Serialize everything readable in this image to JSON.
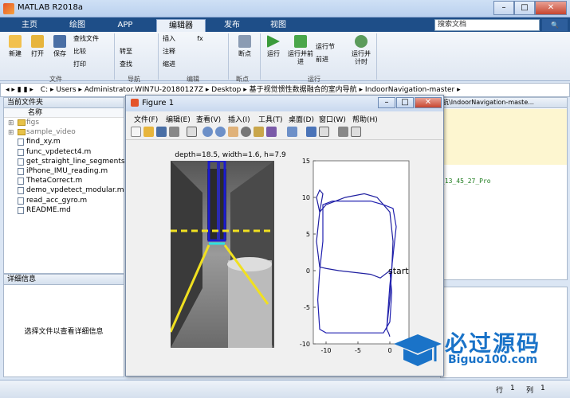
{
  "window": {
    "title": "MATLAB R2018a",
    "min": "–",
    "max": "□",
    "close": "✕"
  },
  "tabs": [
    "主页",
    "绘图",
    "APP",
    "编辑器",
    "发布",
    "视图"
  ],
  "search_placeholder": "搜索文档",
  "ribbon": {
    "buttons": [
      "新建",
      "打开",
      "保存",
      "查找文件",
      "比较",
      "打印",
      "转至",
      "查找",
      "插入",
      "注释",
      "缩进",
      "断点",
      "运行",
      "运行并前进",
      "运行节",
      "前进",
      "运行并计时"
    ],
    "fx": "fx",
    "groups": [
      "文件",
      "导航",
      "编辑",
      "断点",
      "运行"
    ]
  },
  "address": [
    "C:",
    "Users",
    "Administrator.WIN7U-20180127Z",
    "Desktop",
    "基于视觉惯性数据融合的室内导航",
    "IndoorNavigation-master"
  ],
  "current_folder": {
    "title": "当前文件夹",
    "column": "名称",
    "items": [
      {
        "name": "figs",
        "type": "folder"
      },
      {
        "name": "sample_video",
        "type": "folder"
      },
      {
        "name": "find_xy.m",
        "type": "file"
      },
      {
        "name": "func_vpdetect4.m",
        "type": "file"
      },
      {
        "name": "get_straight_line_segments.m",
        "type": "file"
      },
      {
        "name": "iPhone_IMU_reading.m",
        "type": "file"
      },
      {
        "name": "ThetaCorrect.m",
        "type": "file"
      },
      {
        "name": "demo_vpdetect_modular.m",
        "type": "file"
      },
      {
        "name": "read_acc_gyro.m",
        "type": "file"
      },
      {
        "name": "README.md",
        "type": "file"
      }
    ]
  },
  "details": {
    "title": "详细信息",
    "hint": "选择文件以查看详细信息"
  },
  "editor": {
    "path_fragment": "航\\IndoorNavigation-maste...",
    "code_fragment": "_13_45_27_Pro"
  },
  "status": {
    "row_label": "行",
    "row": "1",
    "col_label": "列",
    "col": "1"
  },
  "figure": {
    "title": "Figure 1",
    "menu": [
      "文件(F)",
      "编辑(E)",
      "查看(V)",
      "插入(I)",
      "工具(T)",
      "桌面(D)",
      "窗口(W)",
      "帮助(H)"
    ],
    "image_caption": "depth=18.5, width=1.6, h=7.9",
    "plot_label": "start"
  },
  "chart_data": {
    "type": "line",
    "xlim": [
      -12,
      3
    ],
    "ylim": [
      -10,
      15
    ],
    "xticks": [
      -10,
      -5,
      0
    ],
    "yticks": [
      -10,
      -5,
      0,
      5,
      10,
      15
    ],
    "series": [
      {
        "color": "#1f1fa0",
        "x": [
          0,
          -1.5,
          -3,
          -5,
          -8,
          -10,
          -11,
          -11.5,
          -11,
          -10.5,
          -11,
          -11.5,
          -11,
          -10,
          -7,
          -4,
          -2,
          -1,
          0,
          0.5,
          0.3,
          0,
          -0.5,
          -0.2,
          0
        ],
        "y": [
          0,
          -1,
          -0.5,
          -0.3,
          0,
          0.3,
          0.5,
          4,
          8,
          10.5,
          11,
          10,
          8,
          9,
          10,
          10.5,
          10,
          9,
          8,
          4,
          0,
          -4,
          -8,
          -8.5,
          -9
        ]
      },
      {
        "color": "#2020b0",
        "x": [
          0,
          0.3,
          0,
          -1,
          -4,
          -8,
          -10,
          -11,
          -11.3,
          -11,
          -10.5,
          -10.5,
          -9,
          -6,
          -3,
          -1,
          0.5,
          1,
          0.5,
          0,
          -0.5
        ],
        "y": [
          0,
          -3,
          -7,
          -8.5,
          -8.5,
          -8.5,
          -8.5,
          -8,
          -4,
          0,
          4,
          9,
          9.5,
          9.5,
          9.5,
          9,
          8.5,
          6,
          2,
          -2,
          -8
        ]
      }
    ]
  }
}
